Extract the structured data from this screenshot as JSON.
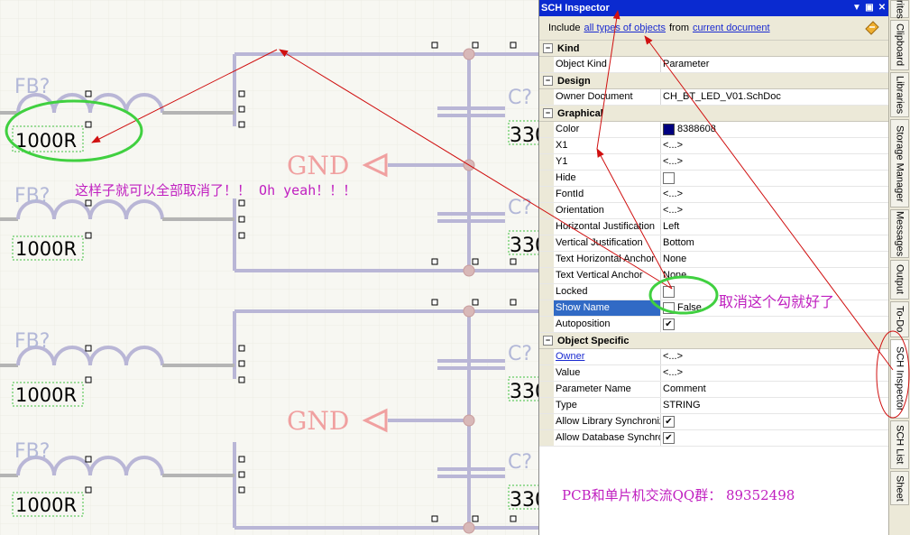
{
  "schematic": {
    "designator": "FB?",
    "value": "1000R",
    "gnd_label": "GND",
    "cap_designator": "C?",
    "cap_value": "330"
  },
  "inspector": {
    "title": "SCH Inspector",
    "filter": {
      "prefix": "Include",
      "scope": "all types of objects",
      "mid": "from",
      "source": "current document"
    },
    "sections": {
      "kind": "Kind",
      "design": "Design",
      "graphical": "Graphical",
      "object_specific": "Object Specific"
    },
    "kind_rows": [
      {
        "name": "Object Kind",
        "value": "Parameter"
      }
    ],
    "design_rows": [
      {
        "name": "Owner Document",
        "value": "CH_BT_LED_V01.SchDoc"
      }
    ],
    "graphical_rows": [
      {
        "name": "Color",
        "value": "8388608"
      },
      {
        "name": "X1",
        "value": "<...>"
      },
      {
        "name": "Y1",
        "value": "<...>"
      },
      {
        "name": "Hide",
        "value": ""
      },
      {
        "name": "FontId",
        "value": "<...>"
      },
      {
        "name": "Orientation",
        "value": "<...>"
      },
      {
        "name": "Horizontal Justification",
        "value": "Left"
      },
      {
        "name": "Vertical Justification",
        "value": "Bottom"
      },
      {
        "name": "Text Horizontal Anchor",
        "value": "None"
      },
      {
        "name": "Text Vertical Anchor",
        "value": "None"
      },
      {
        "name": "Locked",
        "value": ""
      },
      {
        "name": "Show Name",
        "value": "False"
      },
      {
        "name": "Autoposition",
        "value": ""
      }
    ],
    "object_rows": [
      {
        "name": "Owner",
        "value": "<...>"
      },
      {
        "name": "Value",
        "value": "<...>"
      },
      {
        "name": "Parameter Name",
        "value": "Comment"
      },
      {
        "name": "Type",
        "value": "STRING"
      },
      {
        "name": "Allow Library Synchroniz",
        "value": ""
      },
      {
        "name": "Allow Database Synchro",
        "value": ""
      }
    ],
    "color_swatch": "#000080",
    "selection_color": "#316ac5",
    "title_color": "#0a2ad0"
  },
  "side_tabs": [
    "rites",
    "Clipboard",
    "Libraries",
    "Storage Manager",
    "Messages",
    "Output",
    "To-Do",
    "SCH Inspector",
    "SCH List",
    "Sheet"
  ],
  "annotations": {
    "note_main": "这样子就可以全部取消了！！ Oh yeah！！！",
    "note_uncheck": "取消这个勾就好了",
    "note_qq": "PCB和单片机交流QQ群：  89352498",
    "color": "#c020c0"
  }
}
